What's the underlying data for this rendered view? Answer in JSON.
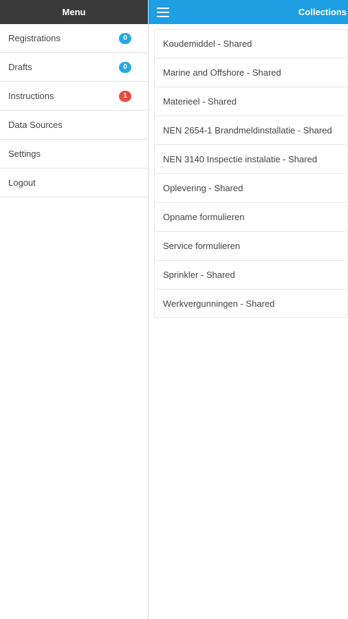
{
  "menu": {
    "title": "Menu",
    "items": [
      {
        "label": "Registrations",
        "badge": "0",
        "badge_color": "#29a8e0"
      },
      {
        "label": "Drafts",
        "badge": "0",
        "badge_color": "#29a8e0"
      },
      {
        "label": "Instructions",
        "badge": "1",
        "badge_color": "#e74c3c"
      },
      {
        "label": "Data Sources"
      },
      {
        "label": "Settings"
      },
      {
        "label": "Logout"
      }
    ]
  },
  "topbar": {
    "title": "Collections",
    "menu_icon": "hamburger-icon"
  },
  "collections": [
    "Koudemiddel - Shared",
    "Marine and Offshore - Shared",
    "Materieel - Shared",
    "NEN 2654-1 Brandmeldinstallatie - Shared",
    "NEN 3140 Inspectie instalatie - Shared",
    "Oplevering - Shared",
    "Opname formulieren",
    "Service formulieren",
    "Sprinkler - Shared",
    "Werkvergunningen - Shared"
  ],
  "colors": {
    "menu_header": "#3a3a3a",
    "topbar": "#1e9fe3",
    "badge_blue": "#29a8e0",
    "badge_red": "#e74c3c"
  }
}
